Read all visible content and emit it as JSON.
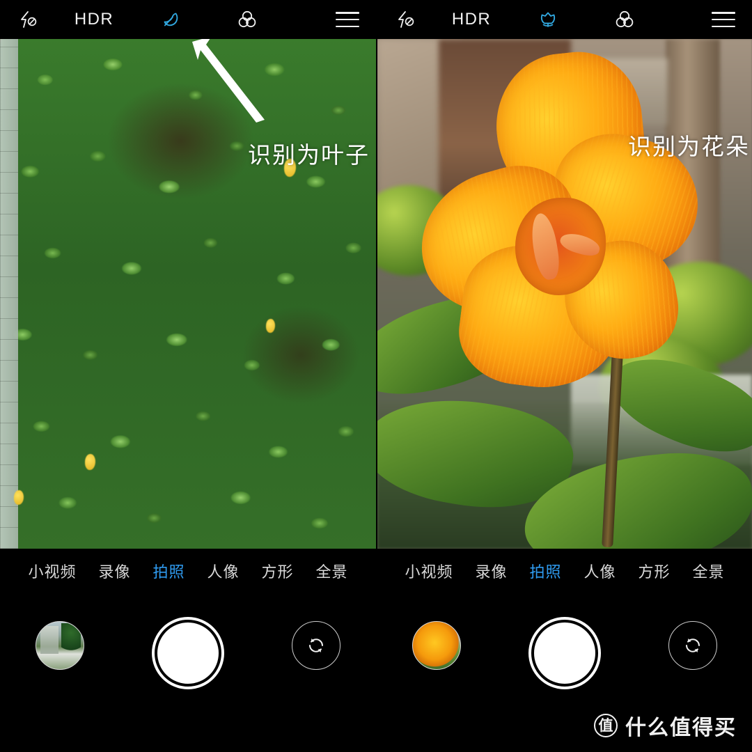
{
  "app": {
    "title": "相机",
    "accent_blue": "#2f9bf0",
    "background": "#000000"
  },
  "panels": [
    {
      "id": "left",
      "toolbar": {
        "flash_icon": "flash-off-icon",
        "flash_label": "闪光灯关闭",
        "hdr_label": "HDR",
        "ai_scene_icon": "leaf-icon",
        "ai_scene_label": "叶子场景识别",
        "ai_scene_active": true,
        "filter_icon": "color-filter-icon",
        "menu_icon": "hamburger-menu-icon"
      },
      "annotation": {
        "text": "识别为叶子",
        "arrow_icon": "arrow-up-left-icon"
      },
      "scene": {
        "name": "green-hedge-foliage",
        "description": "绿色灌木叶丛"
      },
      "modes": [
        {
          "label": "小视频",
          "active": false
        },
        {
          "label": "录像",
          "active": false
        },
        {
          "label": "拍照",
          "active": true
        },
        {
          "label": "人像",
          "active": false
        },
        {
          "label": "方形",
          "active": false
        },
        {
          "label": "全景",
          "active": false
        }
      ],
      "controls": {
        "thumbnail_name": "gallery-thumbnail",
        "shutter_name": "shutter-button",
        "flip_name": "switch-camera-button"
      }
    },
    {
      "id": "right",
      "toolbar": {
        "flash_icon": "flash-off-icon",
        "flash_label": "闪光灯关闭",
        "hdr_label": "HDR",
        "ai_scene_icon": "flower-icon",
        "ai_scene_label": "花朵场景识别",
        "ai_scene_active": true,
        "filter_icon": "color-filter-icon",
        "menu_icon": "hamburger-menu-icon"
      },
      "annotation": {
        "text": "识别为花朵",
        "arrow_icon": "arrow-up-left-icon"
      },
      "scene": {
        "name": "orange-canna-flower",
        "description": "橙黄色美人蕉花朵"
      },
      "modes": [
        {
          "label": "小视频",
          "active": false
        },
        {
          "label": "录像",
          "active": false
        },
        {
          "label": "拍照",
          "active": true
        },
        {
          "label": "人像",
          "active": false
        },
        {
          "label": "方形",
          "active": false
        },
        {
          "label": "全景",
          "active": false
        }
      ],
      "controls": {
        "thumbnail_name": "gallery-thumbnail",
        "shutter_name": "shutter-button",
        "flip_name": "switch-camera-button"
      }
    }
  ],
  "watermark": {
    "badge": "值",
    "text": "什么值得买"
  }
}
